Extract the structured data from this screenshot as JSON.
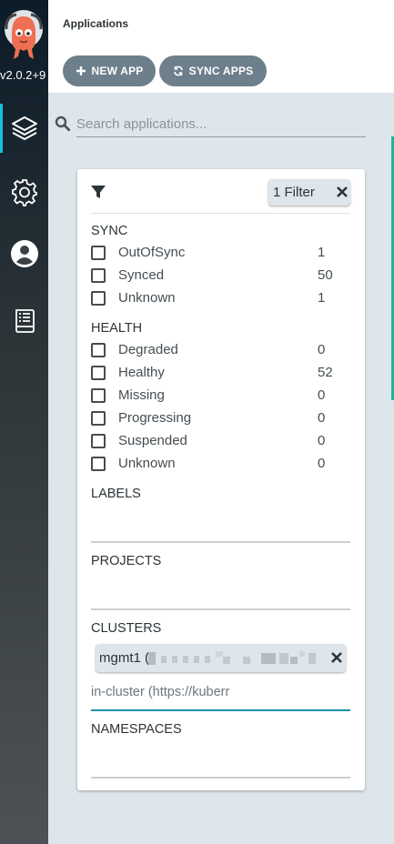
{
  "sidebar": {
    "version": "v2.0.2+9",
    "items": [
      {
        "name": "applications",
        "icon": "layers-icon"
      },
      {
        "name": "settings",
        "icon": "gear-icon"
      },
      {
        "name": "user-info",
        "icon": "user-icon"
      },
      {
        "name": "documentation",
        "icon": "book-icon"
      }
    ]
  },
  "header": {
    "title": "Applications"
  },
  "toolbar": {
    "new_app_label": "NEW APP",
    "sync_apps_label": "SYNC APPS"
  },
  "search": {
    "placeholder": "Search applications..."
  },
  "filters": {
    "chip_label": "1 Filter",
    "sync": {
      "title": "SYNC",
      "items": [
        {
          "label": "OutOfSync",
          "count": "1"
        },
        {
          "label": "Synced",
          "count": "50"
        },
        {
          "label": "Unknown",
          "count": "1"
        }
      ]
    },
    "health": {
      "title": "HEALTH",
      "items": [
        {
          "label": "Degraded",
          "count": "0"
        },
        {
          "label": "Healthy",
          "count": "52"
        },
        {
          "label": "Missing",
          "count": "0"
        },
        {
          "label": "Progressing",
          "count": "0"
        },
        {
          "label": "Suspended",
          "count": "0"
        },
        {
          "label": "Unknown",
          "count": "0"
        }
      ]
    },
    "labels_title": "LABELS",
    "projects_title": "PROJECTS",
    "clusters": {
      "title": "CLUSTERS",
      "selected": "mgmt1 (",
      "input_placeholder": "in-cluster (https://kuberr"
    },
    "namespaces_title": "NAMESPACES"
  },
  "colors": {
    "sidebar_accent": "#18bde1",
    "button": "#6d7f8b",
    "background": "#dee6eb",
    "focus": "#1e8fa8",
    "logo": "#ee6f53"
  }
}
